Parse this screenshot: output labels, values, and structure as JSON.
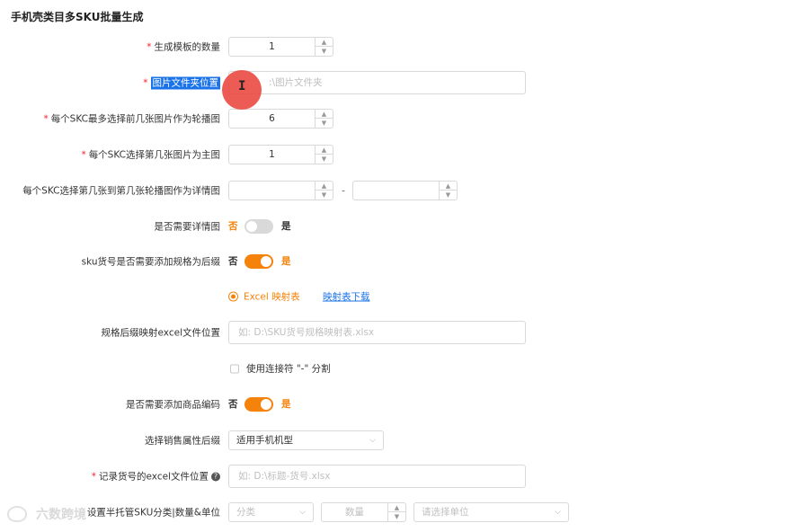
{
  "page": {
    "title": "手机壳类目多SKU批量生成"
  },
  "form": {
    "template_count": {
      "label": "生成模板的数量",
      "required": true,
      "value": "1"
    },
    "image_folder": {
      "label": "图片文件夹位置",
      "required": true,
      "placeholder": "如: D:\\图片文件夹",
      "placeholder_visible": ":\\图片文件夹"
    },
    "max_carousel": {
      "label": "每个SKC最多选择前几张图片作为轮播图",
      "required": true,
      "value": "6"
    },
    "main_image_index": {
      "label": "每个SKC选择第几张图片为主图",
      "required": true,
      "value": "1"
    },
    "detail_range": {
      "label": "每个SKC选择第几张到第几张轮播图作为详情图",
      "from": "",
      "to": "",
      "separator": "-"
    },
    "need_detail": {
      "label": "是否需要详情图",
      "off_label": "否",
      "on_label": "是",
      "on": false
    },
    "sku_suffix": {
      "label": "sku货号是否需要添加规格为后缀",
      "off_label": "否",
      "on_label": "是",
      "on": true
    },
    "mapping": {
      "radio_label": "Excel 映射表",
      "link_label": "映射表下载"
    },
    "mapping_file": {
      "label": "规格后缀映射excel文件位置",
      "placeholder": "如: D:\\SKU货号规格映射表.xlsx"
    },
    "use_hyphen": {
      "label": "使用连接符 \"-\" 分割",
      "checked": false
    },
    "product_code": {
      "label": "是否需要添加商品编码",
      "off_label": "否",
      "on_label": "是",
      "on": true
    },
    "sales_attr": {
      "label": "选择销售属性后缀",
      "value": "适用手机机型"
    },
    "record_file": {
      "label": "记录货号的excel文件位置",
      "required": true,
      "placeholder": "如: D:\\标题-货号.xlsx"
    },
    "semi_managed": {
      "label": "设置半托管SKU分类|数量&单位",
      "category_placeholder": "分类",
      "quantity_placeholder": "数量",
      "unit_placeholder": "请选择单位"
    }
  },
  "watermark": {
    "text": "六数跨境"
  },
  "colors": {
    "accent": "#f5820a",
    "link": "#1a73e8",
    "required": "#f5222d",
    "selection": "#1a73e8",
    "cursor_halo": "#eb463c"
  }
}
